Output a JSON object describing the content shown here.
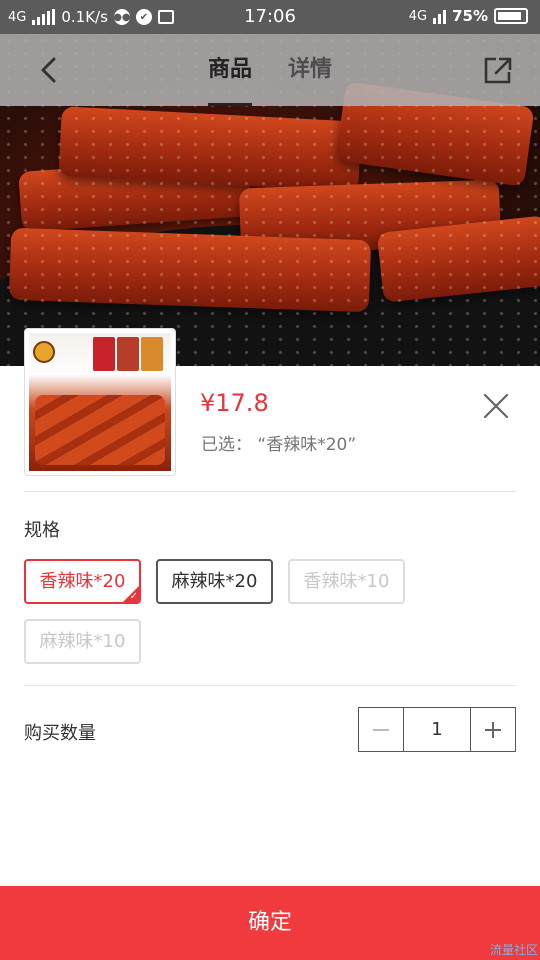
{
  "status_bar": {
    "network_left": "4G",
    "speed": "0.1K/s",
    "time": "17:06",
    "network_right": "4G",
    "battery": "75%",
    "icons": [
      "signal-icon",
      "chat-icon",
      "shield-icon",
      "screenshot-icon",
      "battery-icon"
    ]
  },
  "nav": {
    "tabs": [
      {
        "label": "商品",
        "active": true
      },
      {
        "label": "详情",
        "active": false
      }
    ],
    "back_icon": "chevron-left-icon",
    "share_icon": "share-icon"
  },
  "product": {
    "price": "¥17.8",
    "selected_text": "已选：  “香辣味*20”"
  },
  "spec": {
    "label": "规格",
    "options": [
      {
        "label": "香辣味*20",
        "state": "selected"
      },
      {
        "label": "麻辣味*20",
        "state": "available"
      },
      {
        "label": "香辣味*10",
        "state": "disabled"
      },
      {
        "label": "麻辣味*10",
        "state": "disabled"
      }
    ]
  },
  "quantity": {
    "label": "购买数量",
    "value": "1"
  },
  "confirm_label": "确定",
  "watermark": "流量社区",
  "colors": {
    "accent": "#e8343b",
    "confirm_bg": "#f03a3e",
    "status_bar": "#5b5b5b"
  }
}
